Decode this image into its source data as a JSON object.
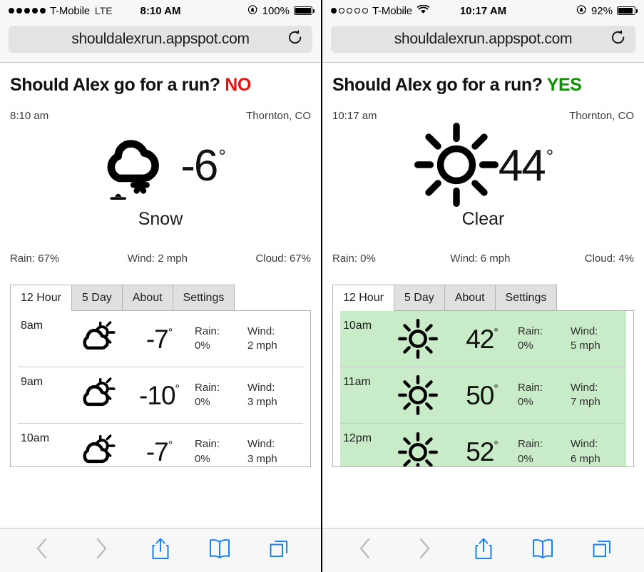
{
  "panels": [
    {
      "status": {
        "signal_dots_filled": 5,
        "signal_dots_total": 5,
        "carrier": "T-Mobile",
        "network": "LTE",
        "network_type": "text",
        "time": "8:10 AM",
        "battery_percent": "100%",
        "battery_level": 100,
        "lock_icon": "rotation-lock-icon"
      },
      "browser": {
        "url": "shouldalexrun.appspot.com",
        "reload_icon": "reload-icon"
      },
      "headline": {
        "question": "Should Alex go for a run?",
        "verdict": "NO",
        "verdict_color": "#e8120f"
      },
      "meta": {
        "time": "8:10 am",
        "location": "Thornton, CO"
      },
      "current": {
        "icon": "cloud-snow-icon",
        "temperature": "-6",
        "degree": "°",
        "condition": "Snow"
      },
      "stats": [
        {
          "label": "Rain:",
          "value": "67%",
          "text": "Rain: 67%"
        },
        {
          "label": "Wind:",
          "value": "2 mph",
          "text": "Wind: 2 mph"
        },
        {
          "label": "Cloud:",
          "value": "67%",
          "text": "Cloud: 67%"
        }
      ],
      "tabs": [
        {
          "label": "12 Hour",
          "active": true
        },
        {
          "label": "5 Day",
          "active": false
        },
        {
          "label": "About",
          "active": false
        },
        {
          "label": "Settings",
          "active": false
        }
      ],
      "hours": [
        {
          "time": "8am",
          "icon": "partly-cloudy-icon",
          "temp": "-7",
          "degree": "°",
          "rain_label": "Rain:",
          "rain": "0%",
          "wind_label": "Wind:",
          "wind": "2 mph",
          "highlight": false
        },
        {
          "time": "9am",
          "icon": "partly-cloudy-icon",
          "temp": "-10",
          "degree": "°",
          "rain_label": "Rain:",
          "rain": "0%",
          "wind_label": "Wind:",
          "wind": "3 mph",
          "highlight": false
        },
        {
          "time": "10am",
          "icon": "partly-cloudy-icon",
          "temp": "-7",
          "degree": "°",
          "rain_label": "Rain:",
          "rain": "0%",
          "wind_label": "Wind:",
          "wind": "3 mph",
          "highlight": false
        }
      ],
      "toolbar": [
        {
          "name": "back-button",
          "icon": "chevron-left-icon",
          "enabled": false
        },
        {
          "name": "forward-button",
          "icon": "chevron-right-icon",
          "enabled": false
        },
        {
          "name": "share-button",
          "icon": "share-icon",
          "enabled": true
        },
        {
          "name": "bookmarks-button",
          "icon": "book-icon",
          "enabled": true
        },
        {
          "name": "tabs-button",
          "icon": "tabs-icon",
          "enabled": true
        }
      ]
    },
    {
      "status": {
        "signal_dots_filled": 1,
        "signal_dots_total": 5,
        "carrier": "T-Mobile",
        "network": "wifi-icon",
        "network_type": "icon",
        "time": "10:17 AM",
        "battery_percent": "92%",
        "battery_level": 92,
        "lock_icon": "rotation-lock-icon"
      },
      "browser": {
        "url": "shouldalexrun.appspot.com",
        "reload_icon": "reload-icon"
      },
      "headline": {
        "question": "Should Alex go for a run?",
        "verdict": "YES",
        "verdict_color": "#0a9400"
      },
      "meta": {
        "time": "10:17 am",
        "location": "Thornton, CO"
      },
      "current": {
        "icon": "sun-icon",
        "temperature": "44",
        "degree": "°",
        "condition": "Clear"
      },
      "stats": [
        {
          "label": "Rain:",
          "value": "0%",
          "text": "Rain: 0%"
        },
        {
          "label": "Wind:",
          "value": "6 mph",
          "text": "Wind: 6 mph"
        },
        {
          "label": "Cloud:",
          "value": "4%",
          "text": "Cloud: 4%"
        }
      ],
      "tabs": [
        {
          "label": "12 Hour",
          "active": true
        },
        {
          "label": "5 Day",
          "active": false
        },
        {
          "label": "About",
          "active": false
        },
        {
          "label": "Settings",
          "active": false
        }
      ],
      "hours": [
        {
          "time": "10am",
          "icon": "sun-icon",
          "temp": "42",
          "degree": "°",
          "rain_label": "Rain:",
          "rain": "0%",
          "wind_label": "Wind:",
          "wind": "5 mph",
          "highlight": true
        },
        {
          "time": "11am",
          "icon": "sun-icon",
          "temp": "50",
          "degree": "°",
          "rain_label": "Rain:",
          "rain": "0%",
          "wind_label": "Wind:",
          "wind": "7 mph",
          "highlight": true
        },
        {
          "time": "12pm",
          "icon": "sun-icon",
          "temp": "52",
          "degree": "°",
          "rain_label": "Rain:",
          "rain": "0%",
          "wind_label": "Wind:",
          "wind": "6 mph",
          "highlight": true
        }
      ],
      "toolbar": [
        {
          "name": "back-button",
          "icon": "chevron-left-icon",
          "enabled": false
        },
        {
          "name": "forward-button",
          "icon": "chevron-right-icon",
          "enabled": false
        },
        {
          "name": "share-button",
          "icon": "share-icon",
          "enabled": true
        },
        {
          "name": "bookmarks-button",
          "icon": "book-icon",
          "enabled": true
        },
        {
          "name": "tabs-button",
          "icon": "tabs-icon",
          "enabled": true
        }
      ]
    }
  ],
  "colors": {
    "highlight_row": "#c8ecc8",
    "toolbar_accent": "#1a82f7",
    "toolbar_disabled": "#bcbcbc"
  }
}
